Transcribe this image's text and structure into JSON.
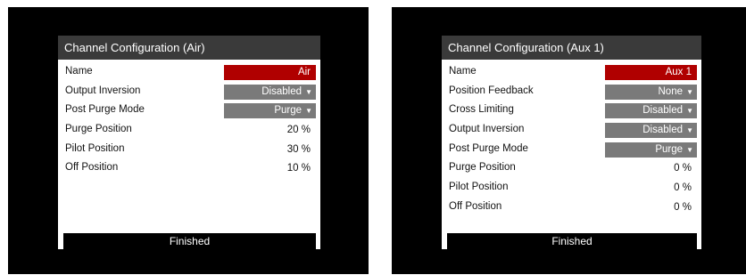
{
  "left": {
    "title": "Channel Configuration  (Air)",
    "rows": [
      {
        "label": "Name",
        "value": "Air",
        "style": "red"
      },
      {
        "label": "Output Inversion",
        "value": "Disabled",
        "style": "gray",
        "icon": "▼"
      },
      {
        "label": "Post Purge Mode",
        "value": "Purge",
        "style": "gray",
        "icon": "▼"
      },
      {
        "label": "Purge Position",
        "value": "20 %",
        "style": "plain"
      },
      {
        "label": "Pilot Position",
        "value": "30 %",
        "style": "plain"
      },
      {
        "label": "Off Position",
        "value": "10 %",
        "style": "plain"
      }
    ],
    "finished_label": "Finished"
  },
  "right": {
    "title": "Channel Configuration  (Aux 1)",
    "rows": [
      {
        "label": "Name",
        "value": "Aux 1",
        "style": "red"
      },
      {
        "label": "Position Feedback",
        "value": "None",
        "style": "gray",
        "icon": "▼"
      },
      {
        "label": "Cross Limiting",
        "value": "Disabled",
        "style": "gray",
        "icon": "▼"
      },
      {
        "label": "Output Inversion",
        "value": "Disabled",
        "style": "gray",
        "icon": "▼"
      },
      {
        "label": "Post Purge Mode",
        "value": "Purge",
        "style": "gray",
        "icon": "▼"
      },
      {
        "label": "Purge Position",
        "value": "0 %",
        "style": "plain"
      },
      {
        "label": "Pilot Position",
        "value": "0 %",
        "style": "plain"
      },
      {
        "label": "Off Position",
        "value": "0 %",
        "style": "plain"
      }
    ],
    "finished_label": "Finished"
  },
  "colors": {
    "title_bar": "#3a3a3a",
    "selected": "#b00000",
    "dropdown": "#7a7a7a",
    "screen": "#000000"
  }
}
